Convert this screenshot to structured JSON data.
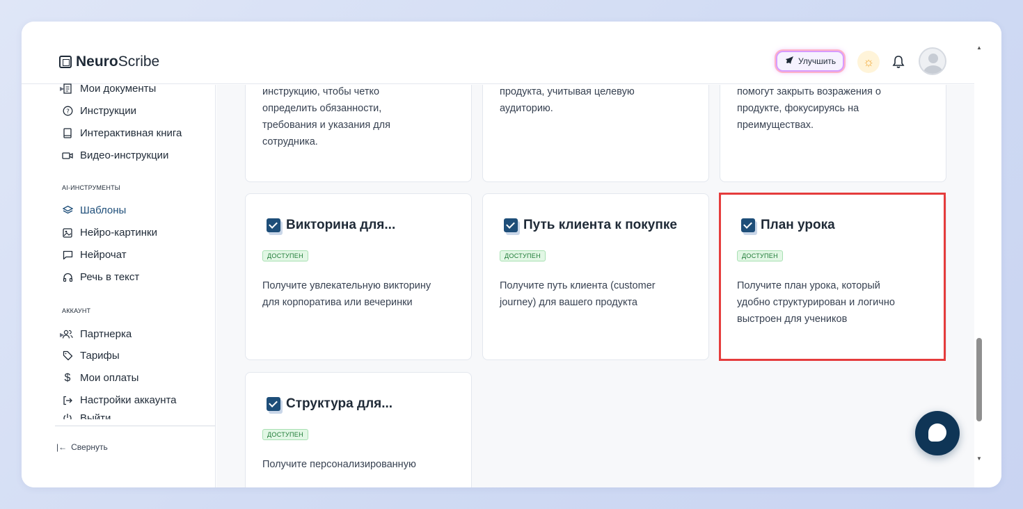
{
  "app": {
    "logo_bold": "Neuro",
    "logo_rest": "Scribe"
  },
  "header": {
    "upgrade_label": "Улучшить"
  },
  "sidebar": {
    "items_top": [
      {
        "label": "Мои документы",
        "icon": "document-icon"
      },
      {
        "label": "Инструкции",
        "icon": "help-circle-icon"
      },
      {
        "label": "Интерактивная книга",
        "icon": "book-icon"
      },
      {
        "label": "Видео-инструкции",
        "icon": "video-icon"
      }
    ],
    "section_ai": "AI-ИНСТРУМЕНТЫ",
    "items_ai": [
      {
        "label": "Шаблоны",
        "icon": "layers-icon",
        "active": true
      },
      {
        "label": "Нейро-картинки",
        "icon": "image-icon"
      },
      {
        "label": "Нейрочат",
        "icon": "chat-icon"
      },
      {
        "label": "Речь в текст",
        "icon": "headphones-icon"
      }
    ],
    "section_account": "АККАУНТ",
    "items_account": [
      {
        "label": "Партнерка",
        "icon": "users-icon"
      },
      {
        "label": "Тарифы",
        "icon": "tag-icon"
      },
      {
        "label": "Мои оплаты",
        "icon": "dollar-icon"
      },
      {
        "label": "Настройки аккаунта",
        "icon": "login-icon"
      },
      {
        "label": "Выйти",
        "icon": "power-icon"
      }
    ],
    "collapse_label": "Свернуть"
  },
  "cards_top_partial": [
    {
      "desc_lines": [
        "инструкцию, чтобы четко",
        "определить обязанности,",
        "требования и указания для",
        "сотрудника."
      ]
    },
    {
      "desc_lines": [
        "продукта, учитывая целевую",
        "аудиторию."
      ]
    },
    {
      "desc_lines": [
        "помогут закрыть возражения о",
        "продукте, фокусируясь на",
        "преимуществах."
      ]
    }
  ],
  "cards": [
    {
      "title": "Викторина для...",
      "badge": "ДОСТУПЕН",
      "desc_lines": [
        "Получите увлекательную викторину",
        "для корпоратива или вечеринки"
      ]
    },
    {
      "title": "Путь клиента к покупке",
      "badge": "ДОСТУПЕН",
      "desc_lines": [
        "Получите путь клиента (customer",
        "journey) для вашего продукта"
      ]
    },
    {
      "title": "План урока",
      "badge": "ДОСТУПЕН",
      "desc_lines": [
        "Получите план урока, который",
        "удобно структурирован и логично",
        "выстроен для учеников"
      ]
    },
    {
      "title": "Структура для...",
      "badge": "ДОСТУПЕН",
      "desc_lines": [
        "Получите персонализированную"
      ]
    }
  ],
  "colors": {
    "accent": "#1e4e79",
    "highlight": "#e53c3c",
    "badge_bg": "#e2f7e5",
    "badge_text": "#1d7a35"
  }
}
